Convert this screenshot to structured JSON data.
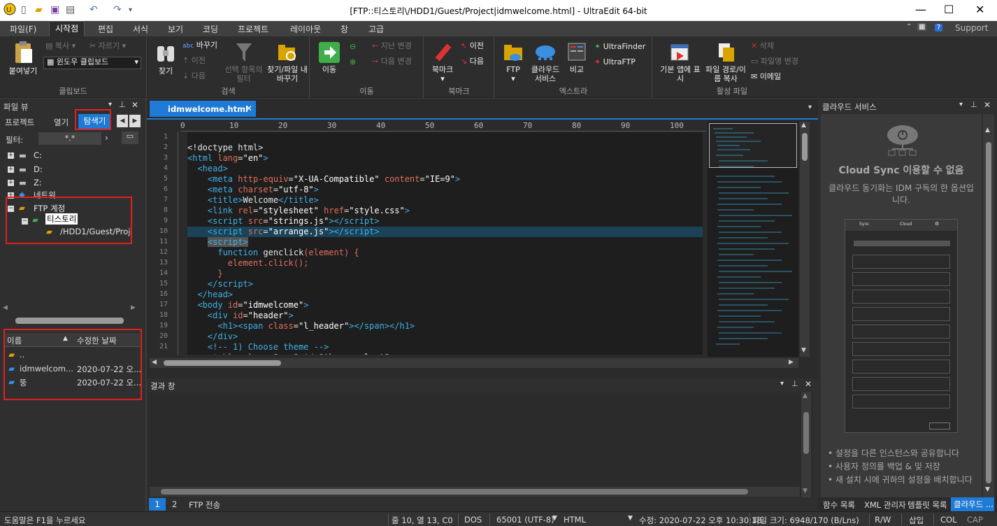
{
  "titlebar": {
    "title": "[FTP::티스토리\\/HDD1/Guest/Project|idmwelcome.html] - UltraEdit 64-bit"
  },
  "menu": [
    "파일(F)",
    "시작점",
    "편집",
    "서식",
    "보기",
    "코딩",
    "프로젝트",
    "레이아웃",
    "창",
    "고급"
  ],
  "support": "Support",
  "ribbon": {
    "clipboard": {
      "paste": "붙여넣기",
      "copy": "복사",
      "cut": "자르기",
      "winclip": "윈도우 클립보드",
      "label": "클립보드"
    },
    "search": {
      "find": "찾기",
      "replace": "바꾸기",
      "prev": "이전",
      "next": "다음",
      "filter": "선택 항목의 필터",
      "findfile": "찾기/파일 내 바꾸기",
      "label": "검색"
    },
    "navigate": {
      "goto": "이동",
      "lastchange": "지난 변경",
      "nextchange": "다음 변경",
      "label": "이동"
    },
    "bookmark": {
      "bm": "북마크",
      "prev": "이전",
      "next": "다음",
      "label": "북마크"
    },
    "extra": {
      "ftp": "FTP",
      "cloud": "클라우드 서비스",
      "compare": "비교",
      "finder": "UltraFinder",
      "ftpapp": "UltraFTP",
      "label": "엑스트라"
    },
    "active": {
      "openapp": "기본 앱에 표시",
      "copypath": "파일 경로/이름 복사",
      "delete": "삭제",
      "rename": "파일명 변경",
      "email": "이메일",
      "label": "활성 파일"
    }
  },
  "fileview": {
    "title": "파일 뷰",
    "tabs": [
      "프로젝트",
      "열기",
      "탐색기"
    ],
    "filter_label": "필터:",
    "filter_value": "*.*",
    "tree": [
      "C:",
      "D:",
      "Z:",
      "네트워",
      "FTP 계정",
      "티스토리",
      "/HDD1/Guest/Proj"
    ],
    "cols": [
      "이름",
      "수정한 날짜"
    ],
    "files": [
      {
        "name": "..",
        "date": ""
      },
      {
        "name": "idmwelcom...",
        "date": "2020-07-22 오..."
      },
      {
        "name": "뚱",
        "date": "2020-07-22 오..."
      }
    ]
  },
  "editor": {
    "tab": "idmwelcome.html",
    "ruler": [
      "0",
      "10",
      "20",
      "30",
      "40",
      "50",
      "60",
      "70",
      "80",
      "90",
      "100"
    ],
    "lines": [
      "1",
      "2",
      "3",
      "4",
      "5",
      "6",
      "7",
      "8",
      "9",
      "10",
      "11",
      "12",
      "13",
      "14",
      "15",
      "16",
      "17",
      "18",
      "19",
      "20",
      "21"
    ]
  },
  "results": {
    "title": "결과 창",
    "tabs": [
      "1",
      "2",
      "FTP 전송"
    ]
  },
  "cloud": {
    "title": "클라우드 서비스",
    "heading": "Cloud Sync 이용할 수 없음",
    "sub": "클라우드 동기화는 IDM 구독의 한 옵션입니다.",
    "bullets": [
      "설정을 다른 인스턴스와 공유합니다",
      "사용자 정의를 백업 & 및 저장",
      "새 설치 시에 귀하의 설정을 배치합니다"
    ],
    "shot_tabs": [
      "Sync",
      "Cloud"
    ]
  },
  "bottomtabs": [
    "함수 목록",
    "XML 관리자",
    "템플릿 목록",
    "클라우드 ..."
  ],
  "status": {
    "help": "도움말은 F1을 누르세요",
    "pos": "줄 10, 열 13, C0",
    "eol": "DOS",
    "enc": "65001 (UTF-8)",
    "lang": "HTML",
    "modified": "수정: 2020-07-22 오후 10:30:18",
    "size": "파일 크기: 6948/170 (B/Lns)",
    "rw": "R/W",
    "ins": "삽입",
    "col": "COL",
    "cap": "CAP"
  }
}
